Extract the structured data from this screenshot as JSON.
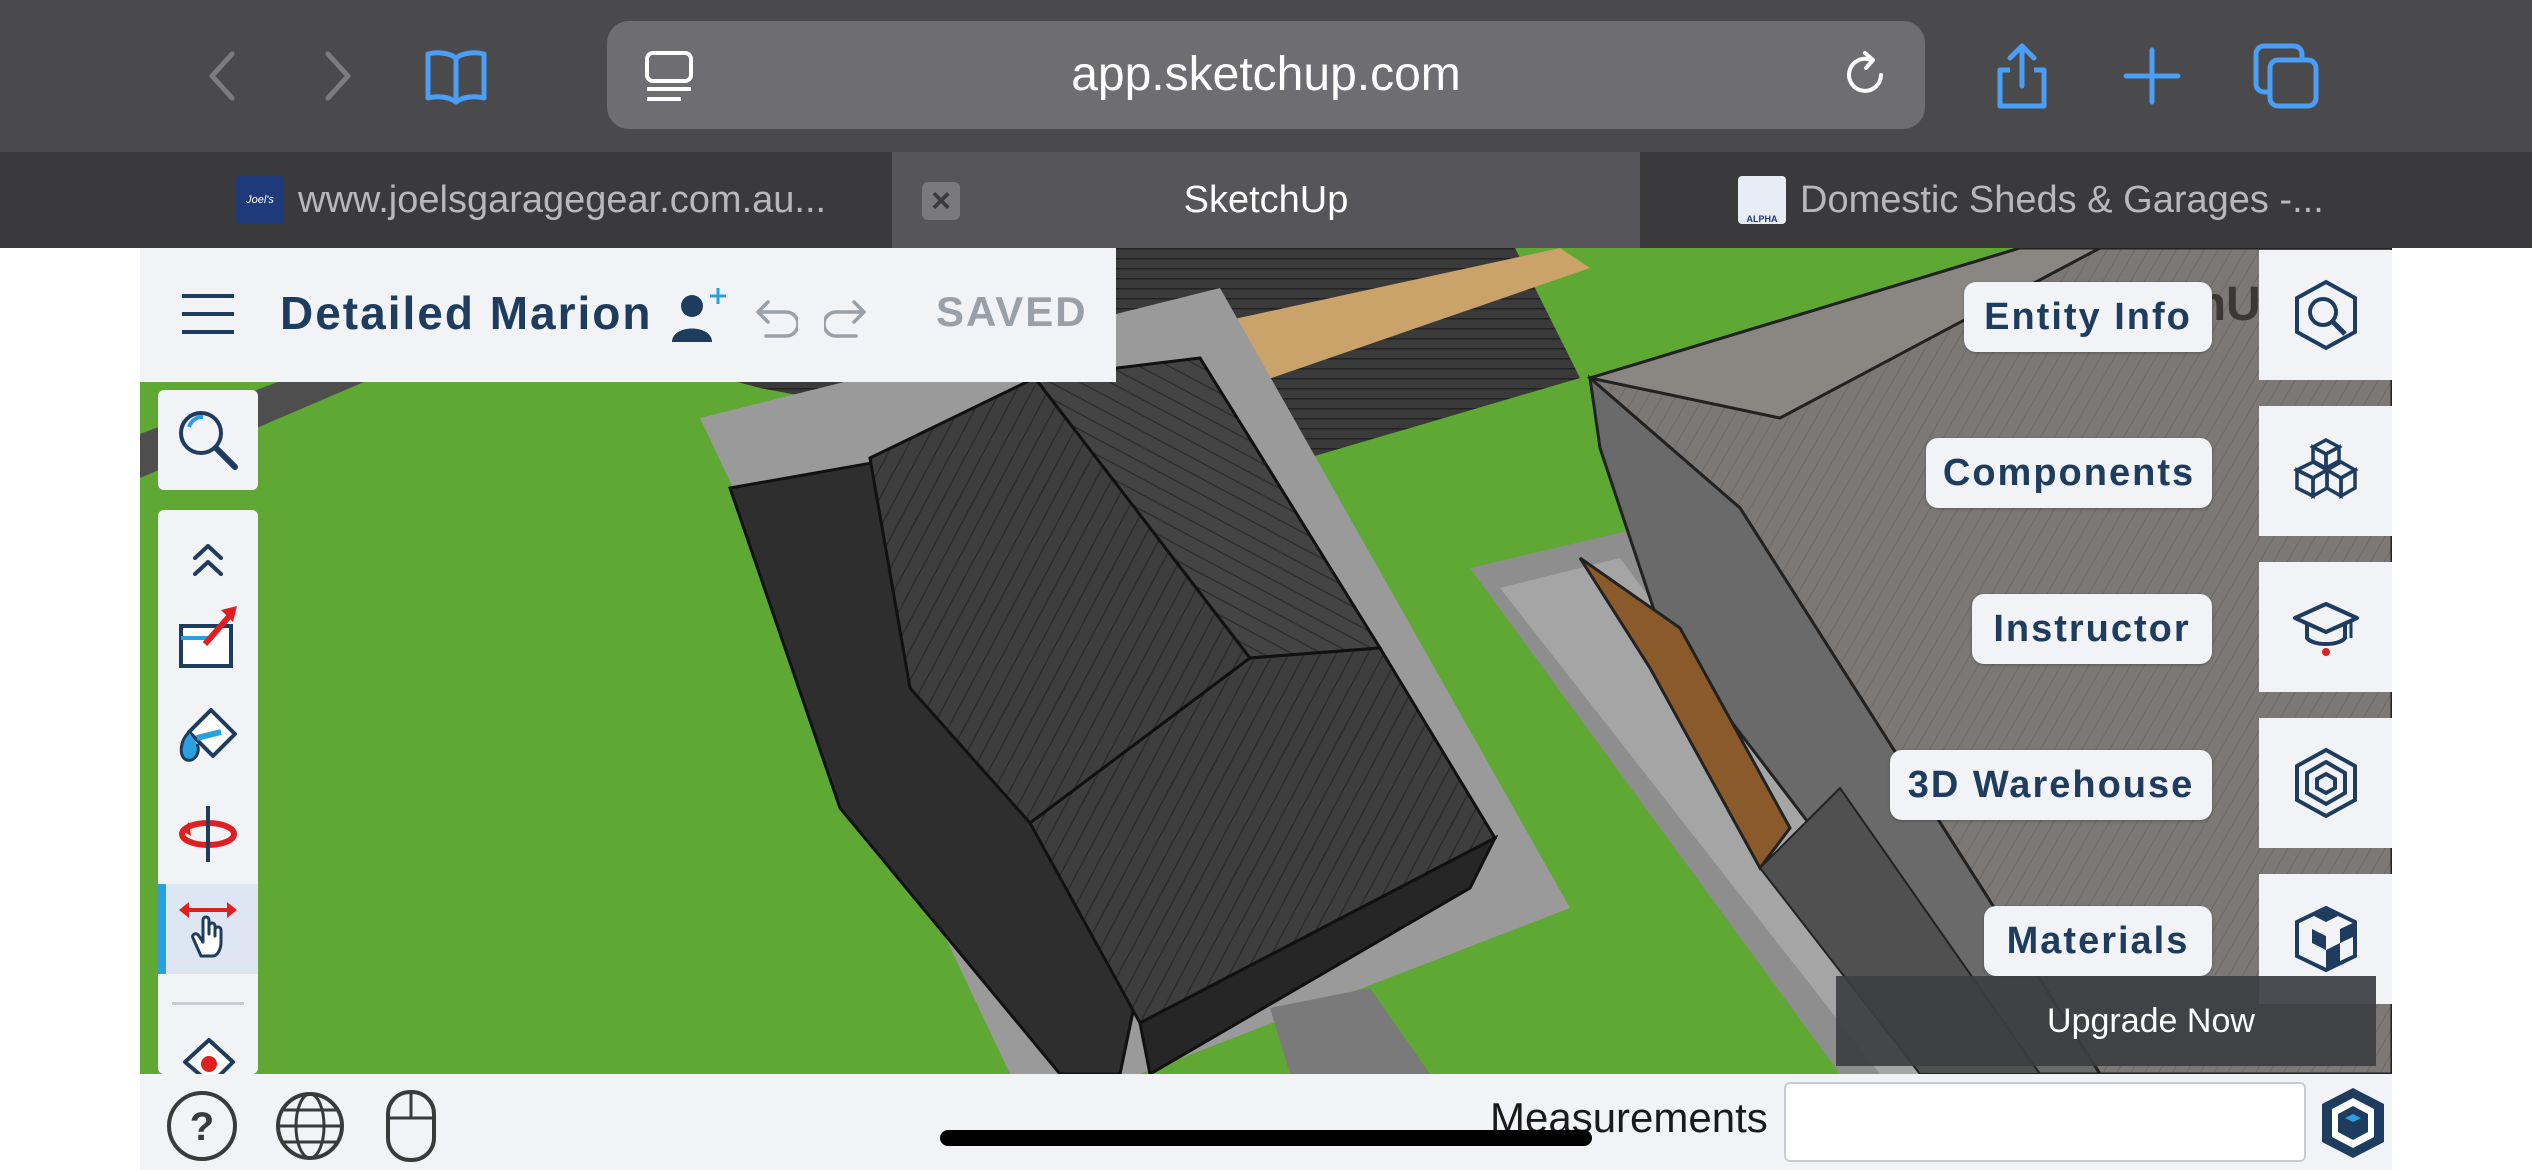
{
  "browser": {
    "url": "app.sketchup.com",
    "icons": {
      "back": "chevron-left-icon",
      "forward": "chevron-right-icon",
      "bookmarks": "book-icon",
      "reader": "reader-icon",
      "reload": "reload-icon",
      "share": "share-icon",
      "new_tab": "plus-icon",
      "tabs": "tabs-icon"
    },
    "accent_color": "#4a9ef5",
    "tabs": [
      {
        "title": "www.joelsgaragegear.com.au...",
        "favicon_text": "Joel's",
        "active": false
      },
      {
        "title": "SketchUp",
        "active": true
      },
      {
        "title": "Domestic Sheds & Garages -...",
        "favicon_text": "ALPHA",
        "active": false
      }
    ]
  },
  "app": {
    "document_title": "Detailed Marion",
    "save_status": "SAVED",
    "brand_color": "#1d3c5e",
    "left_tools": [
      {
        "name": "search-tool",
        "icon": "search-icon"
      },
      {
        "name": "expand-tools",
        "icon": "double-chevron-up-icon"
      },
      {
        "name": "push-pull-tool",
        "icon": "push-pull-icon"
      },
      {
        "name": "paint-bucket-tool",
        "icon": "paint-bucket-icon"
      },
      {
        "name": "orbit-tool",
        "icon": "orbit-icon"
      },
      {
        "name": "pan-tool",
        "icon": "pan-icon",
        "selected": true
      },
      {
        "name": "eraser-tool",
        "icon": "eraser-icon"
      }
    ],
    "right_panels": [
      {
        "label": "Entity Info",
        "icon": "entity-info-icon"
      },
      {
        "label": "Components",
        "icon": "components-icon"
      },
      {
        "label": "Instructor",
        "icon": "instructor-icon"
      },
      {
        "label": "3D Warehouse",
        "icon": "warehouse-icon"
      },
      {
        "label": "Materials",
        "icon": "materials-icon"
      }
    ],
    "upgrade_label": "Upgrade Now",
    "bottom": {
      "measurements_label": "Measurements",
      "measurements_value": "",
      "icons": [
        "help-icon",
        "globe-icon",
        "mouse-icon",
        "sketchup-logo-icon"
      ]
    },
    "watermark_text": "chU"
  }
}
